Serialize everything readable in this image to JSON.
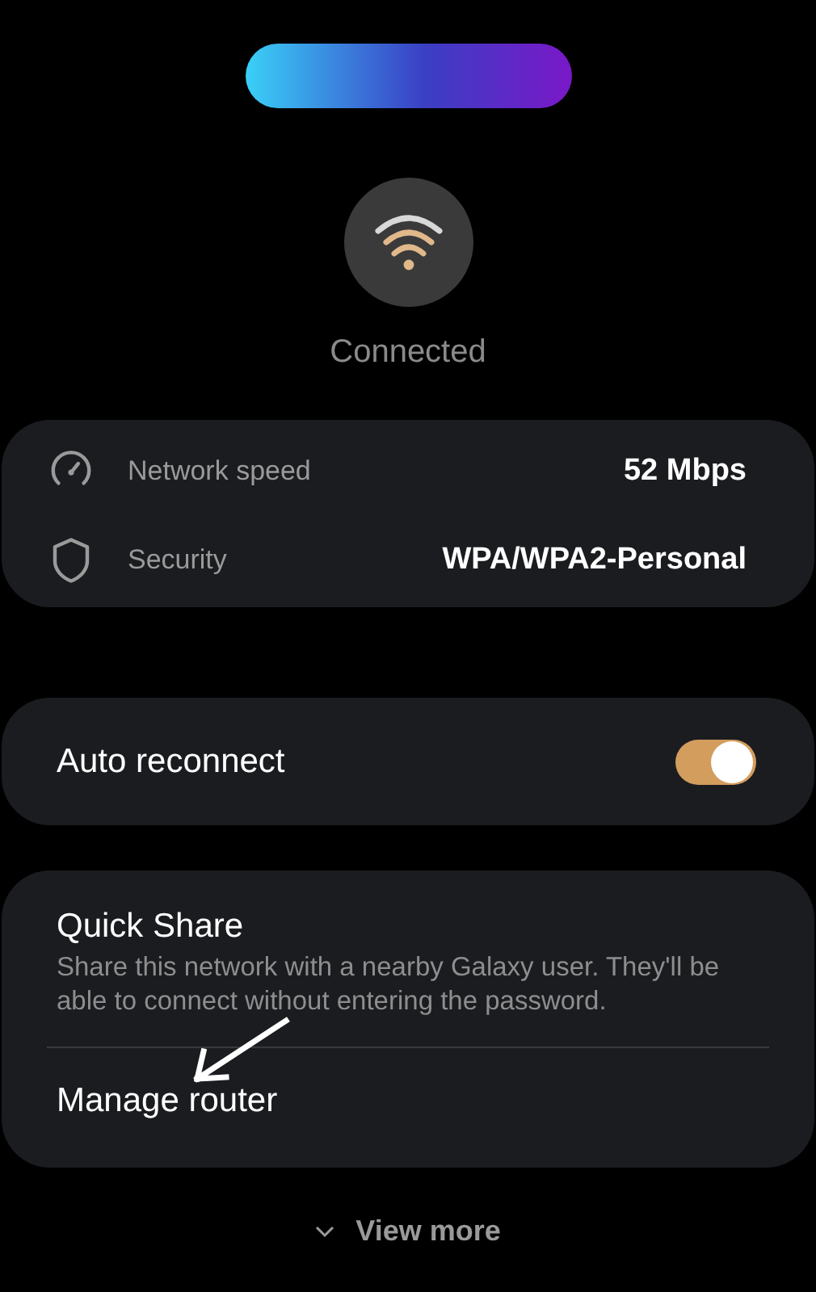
{
  "status": {
    "label": "Connected"
  },
  "details": [
    {
      "kind": "speed",
      "label": "Network speed",
      "value": "52 Mbps"
    },
    {
      "kind": "security",
      "label": "Security",
      "value": "WPA/WPA2-Personal"
    }
  ],
  "auto_reconnect": {
    "label": "Auto reconnect",
    "on": true
  },
  "options": [
    {
      "title": "Quick Share",
      "description": "Share this network with a nearby Galaxy user. They'll be able to connect without entering the password."
    },
    {
      "title": "Manage router"
    }
  ],
  "view_more": {
    "label": "View more"
  }
}
